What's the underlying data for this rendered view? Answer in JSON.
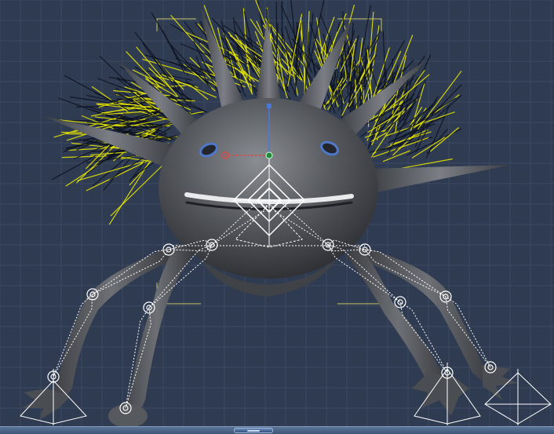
{
  "viewport": {
    "label": "",
    "grid_color": "#3d4a62",
    "background": "#2e3b51",
    "frame_color": "#c7c36a",
    "hair_guide_color": "#e6e600",
    "hair_color": "#0d1220",
    "bone_color": "#ffffff",
    "body_color": "#4a4d52",
    "eye_color": "#4f78c9"
  },
  "rig": {
    "root_manipulator": "move-rotate-gizmo",
    "bones": [
      "spine",
      "head",
      "leg-front-left",
      "leg-front-right",
      "leg-back-left",
      "leg-back-right"
    ]
  },
  "status_bar": {
    "handle_icon": "splitter-grip-icon"
  }
}
